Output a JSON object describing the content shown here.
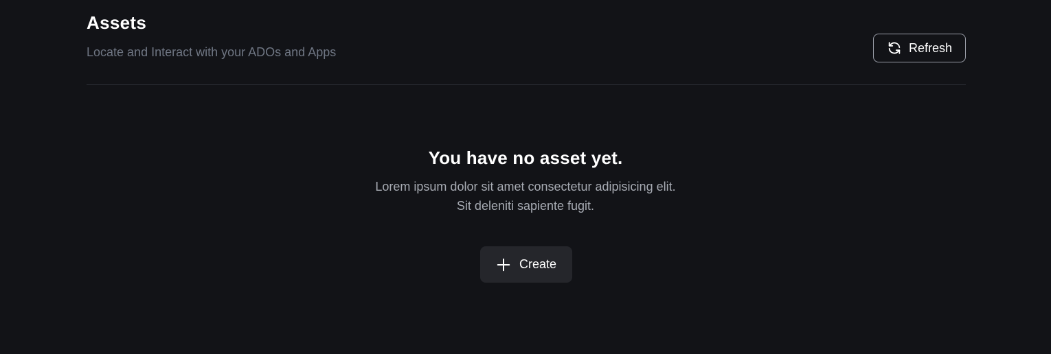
{
  "header": {
    "title": "Assets",
    "subtitle": "Locate and Interact with your ADOs and Apps",
    "refresh_label": "Refresh",
    "refresh_icon": "refresh-icon"
  },
  "empty_state": {
    "title": "You have no asset yet.",
    "description_line1": "Lorem ipsum dolor sit amet consectetur adipisicing elit.",
    "description_line2": "Sit deleniti sapiente fugit.",
    "create_label": "Create",
    "create_icon": "plus-icon"
  },
  "colors": {
    "background": "#121317",
    "primary_text": "#ffffff",
    "muted_text": "#6f7683",
    "secondary_text": "#a7abb3",
    "divider": "#2a2c33",
    "button_background": "#25262b",
    "button_border": "#9a9ea8"
  }
}
